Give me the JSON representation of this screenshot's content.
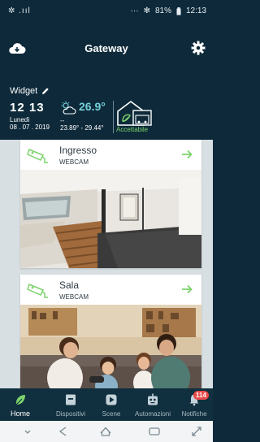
{
  "status_bar": {
    "left_icons": "✲ .ııl",
    "battery_text": "81%",
    "time": "12:13"
  },
  "header": {
    "title": "Gateway"
  },
  "widget": {
    "label": "Widget",
    "time": "12 13",
    "day": "Lunedì",
    "date": "08 . 07 . 2019",
    "temperature": "26.9°",
    "weather_dash": "--",
    "temp_range": "23.89° - 29.44°",
    "house_state": "Accettabile"
  },
  "cameras": [
    {
      "name": "Ingresso",
      "type": "WEBCAM"
    },
    {
      "name": "Sala",
      "type": "WEBCAM"
    }
  ],
  "bottom_nav": {
    "items": [
      {
        "label": "Home",
        "icon": "leaf-icon"
      },
      {
        "label": "Dispositivi",
        "icon": "device-icon"
      },
      {
        "label": "Scene",
        "icon": "play-icon"
      },
      {
        "label": "Automazioni",
        "icon": "robot-icon"
      },
      {
        "label": "Notifiche",
        "icon": "bell-icon"
      }
    ],
    "notification_count": "114"
  },
  "colors": {
    "primary_dark": "#0e2a3a",
    "accent_green": "#7cd36b",
    "temp_cyan": "#73d0d8",
    "badge_red": "#e64a4a"
  }
}
